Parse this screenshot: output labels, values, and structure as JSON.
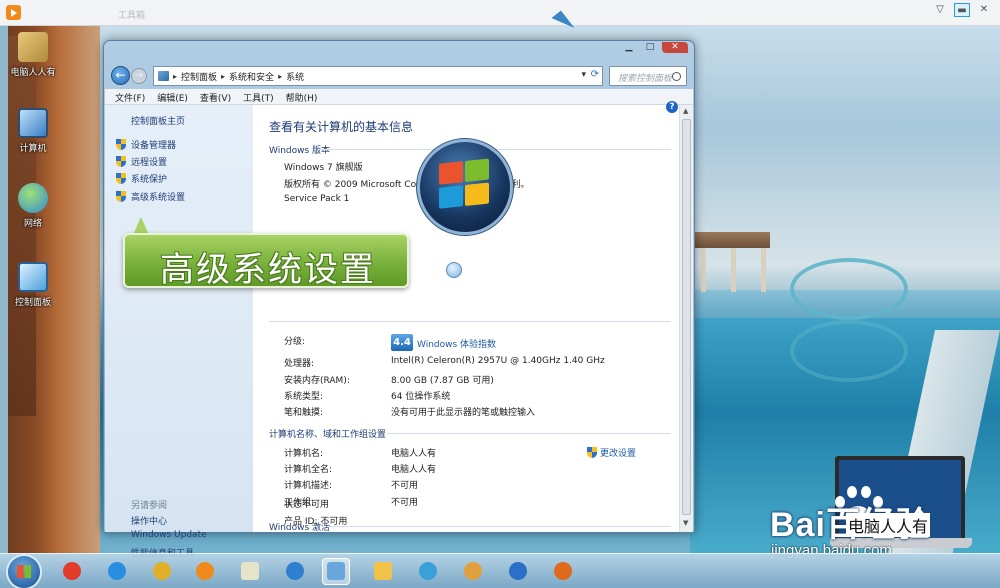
{
  "host": {
    "faint_title": "工具箱"
  },
  "desktop_icons": [
    {
      "label": "电脑人人有",
      "color": "#caa35a"
    },
    {
      "label": "计算机",
      "color": "#3a7fc6"
    },
    {
      "label": "网络",
      "color": "#2e8ad0"
    },
    {
      "label": "控制面板",
      "color": "#4aa0dc"
    }
  ],
  "window": {
    "breadcrumb": [
      "控制面板",
      "系统和安全",
      "系统"
    ],
    "search_placeholder": "搜索控制面板",
    "menu": [
      "文件(F)",
      "编辑(E)",
      "查看(V)",
      "工具(T)",
      "帮助(H)"
    ],
    "left_pane": {
      "home": "控制面板主页",
      "links": [
        "设备管理器",
        "远程设置",
        "系统保护",
        "高级系统设置"
      ],
      "see_also_label": "另请参阅",
      "see_also": [
        "操作中心",
        "Windows Update",
        "性能信息和工具"
      ]
    },
    "content": {
      "title": "查看有关计算机的基本信息",
      "edition_section": "Windows 版本",
      "edition_name": "Windows 7 旗舰版",
      "copyright": "版权所有 © 2009 Microsoft Corporation。保留所有权利。",
      "service_pack": "Service Pack 1",
      "system": {
        "rating_label": "分级:",
        "rating_score": "4.4",
        "rating_link": "Windows 体验指数",
        "rows": [
          {
            "label": "处理器:",
            "value": "Intel(R) Celeron(R) 2957U @ 1.40GHz   1.40 GHz"
          },
          {
            "label": "安装内存(RAM):",
            "value": "8.00 GB (7.87 GB 可用)"
          },
          {
            "label": "系统类型:",
            "value": "64 位操作系统"
          },
          {
            "label": "笔和触摸:",
            "value": "没有可用于此显示器的笔或触控输入"
          }
        ]
      },
      "computer_section": "计算机名称、域和工作组设置",
      "change_settings": "更改设置",
      "computer_rows": [
        {
          "label": "计算机名:",
          "value": "电脑人人有"
        },
        {
          "label": "计算机全名:",
          "value": "电脑人人有"
        },
        {
          "label": "计算机描述:",
          "value": "不可用"
        },
        {
          "label": "工作组:",
          "value": "不可用"
        }
      ],
      "activation_section": "Windows 激活",
      "activation_status": "状态不可用",
      "product_id": "产品 ID: 不可用"
    }
  },
  "callout": {
    "text": "高级系统设置"
  },
  "taskbar": {
    "items": [
      {
        "name": "jiang-app",
        "color": "#e23b2a"
      },
      {
        "name": "ie",
        "color": "#2a8ee0"
      },
      {
        "name": "chrome",
        "color": "#e0b02a"
      },
      {
        "name": "media-player",
        "color": "#f08a1c"
      },
      {
        "name": "whiteboard",
        "color": "#e7e3c8"
      },
      {
        "name": "browser-blue",
        "color": "#2e7fd0"
      },
      {
        "name": "control-panel",
        "color": "#6aa8dc"
      },
      {
        "name": "file-explorer",
        "color": "#f0c24a"
      },
      {
        "name": "pinwheel",
        "color": "#3aa0d8"
      },
      {
        "name": "paint",
        "color": "#e0a040"
      },
      {
        "name": "network-app",
        "color": "#2a6fc8"
      },
      {
        "name": "firefox",
        "color": "#e06a1c"
      }
    ]
  },
  "watermark": {
    "brand": "Bai百经验",
    "tag": "电脑人人有",
    "url": "jingyan.baidu.com"
  }
}
